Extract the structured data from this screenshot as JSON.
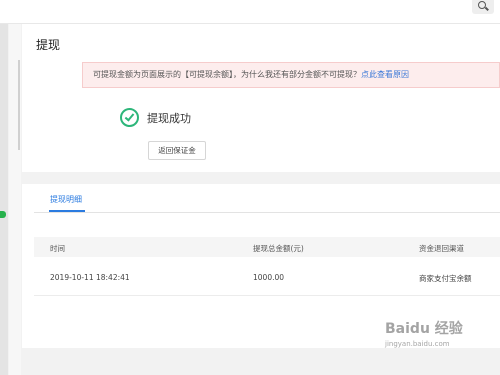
{
  "topbar": {
    "search_icon": "search-icon"
  },
  "page": {
    "title": "提现"
  },
  "notice": {
    "text": "可提现金额为页面展示的【可提现余额】，为什么我还有部分金额不可提现？",
    "link": "点此查看原因"
  },
  "result": {
    "status_icon": "check-circle-icon",
    "text": "提现成功",
    "back_button": "返回保证金"
  },
  "details": {
    "tab": "提现明细",
    "columns": [
      "时间",
      "提现总金额(元)",
      "资金退回渠道"
    ],
    "rows": [
      [
        "2019-10-11 18:42:41",
        "1000.00",
        "商家支付宝余额"
      ]
    ]
  },
  "watermark": {
    "main": "Baidu 经验",
    "sub": "jingyan.baidu.com"
  },
  "colors": {
    "accent": "#2b7be0",
    "success": "#2db67a",
    "notice_bg": "#fdeded"
  }
}
